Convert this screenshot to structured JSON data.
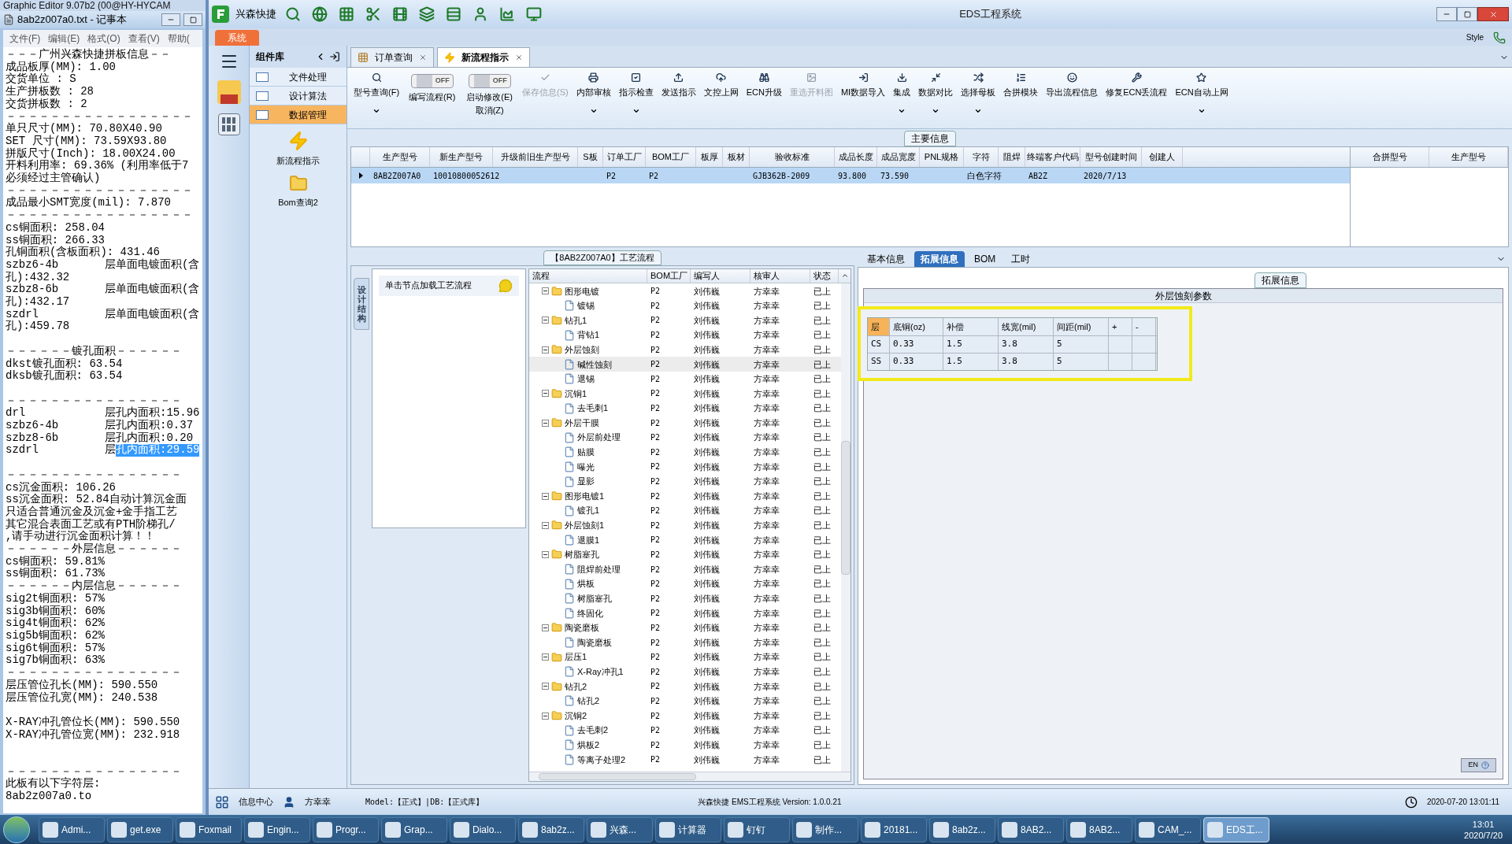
{
  "notepad": {
    "behind_title": "Graphic Editor 9.07b2 (00@HY-HYCAM",
    "title": "8ab2z007a0.txt - 记事本",
    "menu": [
      "文件(F)",
      "编辑(E)",
      "格式(O)",
      "查看(V)",
      "帮助("
    ],
    "lines": [
      {
        "kind": "text",
        "text": "－－－广州兴森快捷拼板信息－－"
      },
      {
        "kind": "text",
        "text": "成品板厚(MM): 1.00"
      },
      {
        "kind": "text",
        "text": "交货单位 : S"
      },
      {
        "kind": "text",
        "text": "生产拼板数 : 28"
      },
      {
        "kind": "text",
        "text": "交货拼板数 : 2"
      },
      {
        "kind": "text",
        "text": "－－－－－－－－－－－－－－－－－"
      },
      {
        "kind": "text",
        "text": "单只尺寸(MM): 70.80X40.90"
      },
      {
        "kind": "text",
        "text": "SET 尺寸(MM): 73.59X93.80"
      },
      {
        "kind": "text",
        "text": "拼版尺寸(Inch): 18.00X24.00"
      },
      {
        "kind": "text",
        "text": "开料利用率: 69.36% (利用率低于7"
      },
      {
        "kind": "text",
        "text": "必须经过主管确认)"
      },
      {
        "kind": "text",
        "text": "－－－－－－－－－－－－－－－－－"
      },
      {
        "kind": "text",
        "text": "成品最小SMT宽度(mil): 7.870"
      },
      {
        "kind": "text",
        "text": "－－－－－－－－－－－－－－－－－"
      },
      {
        "kind": "text",
        "text": "cs铜面积: 258.04"
      },
      {
        "kind": "text",
        "text": "ss铜面积: 266.33"
      },
      {
        "kind": "text",
        "text": "孔铜面积(含板面积): 431.46"
      },
      {
        "kind": "text",
        "text": "szbz6-4b       层单面电镀面积(含"
      },
      {
        "kind": "text",
        "text": "孔):432.32"
      },
      {
        "kind": "text",
        "text": "szbz8-6b       层单面电镀面积(含"
      },
      {
        "kind": "text",
        "text": "孔):432.17"
      },
      {
        "kind": "text",
        "text": "szdrl          层单面电镀面积(含"
      },
      {
        "kind": "text",
        "text": "孔):459.78"
      },
      {
        "kind": "blank"
      },
      {
        "kind": "text",
        "text": "－－－－－－镀孔面积－－－－－－"
      },
      {
        "kind": "text",
        "text": "dkst镀孔面积: 63.54"
      },
      {
        "kind": "text",
        "text": "dksb镀孔面积: 63.54"
      },
      {
        "kind": "blank"
      },
      {
        "kind": "text",
        "text": "－－－－－－－－－－－－－－－－"
      },
      {
        "kind": "text",
        "text": "drl            层孔内面积:15.96"
      },
      {
        "kind": "text",
        "text": "szbz6-4b       层孔内面积:0.37"
      },
      {
        "kind": "text",
        "text": "szbz8-6b       层孔内面积:0.20"
      },
      {
        "kind": "highlight",
        "text": "szdrl          层",
        "highlight": "孔内面积:29.59"
      },
      {
        "kind": "blank"
      },
      {
        "kind": "text",
        "text": "－－－－－－－－－－－－－－－－"
      },
      {
        "kind": "text",
        "text": "cs沉金面积: 106.26"
      },
      {
        "kind": "text",
        "text": "ss沉金面积: 52.84自动计算沉金面"
      },
      {
        "kind": "text",
        "text": "只适合普通沉金及沉金+金手指工艺"
      },
      {
        "kind": "text",
        "text": "其它混合表面工艺或有PTH阶梯孔/"
      },
      {
        "kind": "text",
        "text": ",请手动进行沉金面积计算！！"
      },
      {
        "kind": "text",
        "text": "－－－－－－外层信息－－－－－－"
      },
      {
        "kind": "text",
        "text": "cs铜面积: 59.81%"
      },
      {
        "kind": "text",
        "text": "ss铜面积: 61.73%"
      },
      {
        "kind": "text",
        "text": "－－－－－－内层信息－－－－－－"
      },
      {
        "kind": "text",
        "text": "sig2t铜面积: 57%"
      },
      {
        "kind": "text",
        "text": "sig3b铜面积: 60%"
      },
      {
        "kind": "text",
        "text": "sig4t铜面积: 62%"
      },
      {
        "kind": "text",
        "text": "sig5b铜面积: 62%"
      },
      {
        "kind": "text",
        "text": "sig6t铜面积: 57%"
      },
      {
        "kind": "text",
        "text": "sig7b铜面积: 63%"
      },
      {
        "kind": "text",
        "text": "－－－－－－－－－－－－－－－－"
      },
      {
        "kind": "text",
        "text": "层压管位孔长(MM): 590.550"
      },
      {
        "kind": "text",
        "text": "层压管位孔宽(MM): 240.538"
      },
      {
        "kind": "blank"
      },
      {
        "kind": "text",
        "text": "X-RAY冲孔管位长(MM): 590.550"
      },
      {
        "kind": "text",
        "text": "X-RAY冲孔管位宽(MM): 232.918"
      },
      {
        "kind": "blank"
      },
      {
        "kind": "blank"
      },
      {
        "kind": "text",
        "text": "－－－－－－－－－－－－－－－－"
      },
      {
        "kind": "text",
        "text": "此板有以下字符层:"
      },
      {
        "kind": "text",
        "text": "8ab2z007a0.to"
      }
    ]
  },
  "app": {
    "quick_title": "兴森快捷",
    "title": "EDS工程系统",
    "system_tab": "系统",
    "style_label": "Style"
  },
  "sidebar": {
    "header": "组件库",
    "items": [
      {
        "label": "文件处理",
        "selected": false
      },
      {
        "label": "设计算法",
        "selected": false
      },
      {
        "label": "数据管理",
        "selected": true
      }
    ],
    "launchers": [
      {
        "label": "新流程指示",
        "kind": "lightning"
      },
      {
        "label": "Bom查询2",
        "kind": "folder"
      }
    ]
  },
  "doc_tabs": [
    {
      "label": "订单查询",
      "selected": false
    },
    {
      "label": "新流程指示",
      "selected": true
    }
  ],
  "ribbon": [
    {
      "kind": "button",
      "label": "型号查询(F)",
      "dropdown": true,
      "disabled": false
    },
    {
      "kind": "toggle",
      "label": "编写流程(R)",
      "on": false,
      "state_text": "OFF"
    },
    {
      "kind": "toggle",
      "label": "启动修改(E)",
      "sub": "取消(Z)",
      "on": false,
      "state_text": "OFF"
    },
    {
      "kind": "button",
      "label": "保存信息(S)",
      "dropdown": false,
      "disabled": true
    },
    {
      "kind": "button",
      "label": "内部审核",
      "dropdown": true,
      "disabled": false
    },
    {
      "kind": "button",
      "label": "指示检查",
      "dropdown": true,
      "disabled": false
    },
    {
      "kind": "button",
      "label": "发送指示",
      "dropdown": false,
      "disabled": false
    },
    {
      "kind": "button",
      "label": "文控上网",
      "dropdown": false,
      "disabled": false
    },
    {
      "kind": "button",
      "label": "ECN升级",
      "dropdown": false,
      "disabled": false
    },
    {
      "kind": "button",
      "label": "重选开料图",
      "dropdown": false,
      "disabled": true
    },
    {
      "kind": "button",
      "label": "MI数据导入",
      "dropdown": false,
      "disabled": false
    },
    {
      "kind": "button",
      "label": "集成",
      "dropdown": true,
      "disabled": false
    },
    {
      "kind": "button",
      "label": "数据对比",
      "dropdown": true,
      "disabled": false
    },
    {
      "kind": "button",
      "label": "选择母板",
      "dropdown": true,
      "disabled": false
    },
    {
      "kind": "button",
      "label": "合拼模块",
      "dropdown": false,
      "disabled": false
    },
    {
      "kind": "button",
      "label": "导出流程信息",
      "dropdown": false,
      "disabled": false
    },
    {
      "kind": "button",
      "label": "修复ECN丢流程",
      "dropdown": false,
      "disabled": false
    },
    {
      "kind": "button",
      "label": "ECN自动上网",
      "dropdown": true,
      "disabled": false
    }
  ],
  "main_info": {
    "title": "主要信息",
    "columns": [
      "生产型号",
      "新生产型号",
      "升级前旧生产型号",
      "S板",
      "订单工厂",
      "BOM工厂",
      "板厚",
      "板材",
      "验收标准",
      "成品长度",
      "成品宽度",
      "PNL规格",
      "字符",
      "阻焊",
      "终端客户代码",
      "型号创建时间",
      "创建人"
    ],
    "rows": [
      {
        "selected": true,
        "cells": [
          "8AB2Z007A0",
          "10010800052612",
          null,
          null,
          "P2",
          "P2",
          null,
          null,
          "GJB362B-2009",
          "93.800",
          "73.590",
          null,
          "白色字符",
          null,
          "AB2Z",
          "2020/7/13",
          null
        ]
      }
    ],
    "side_columns": [
      "合拼型号",
      "生产型号"
    ]
  },
  "flow": {
    "title": "【8AB2Z007A0】工艺流程",
    "side_tab": "设计结构",
    "hint": "单击节点加载工艺流程",
    "columns": [
      "流程",
      "BOM工厂",
      "编写人",
      "核审人",
      "状态"
    ],
    "tree": [
      {
        "name": "图形电镀",
        "bom": "P2",
        "writer": "刘伟巍",
        "reviewer": "方幸幸",
        "status": "已上",
        "selected": false,
        "expanded": true,
        "children": [
          {
            "name": "镀锡",
            "bom": "P2",
            "writer": "刘伟巍",
            "reviewer": "方幸幸",
            "status": "已上",
            "selected": false
          }
        ]
      },
      {
        "name": "钻孔1",
        "bom": "P2",
        "writer": "刘伟巍",
        "reviewer": "方幸幸",
        "status": "已上",
        "selected": false,
        "expanded": true,
        "children": [
          {
            "name": "背钻1",
            "bom": "P2",
            "writer": "刘伟巍",
            "reviewer": "方幸幸",
            "status": "已上",
            "selected": false
          }
        ]
      },
      {
        "name": "外层蚀刻",
        "bom": "P2",
        "writer": "刘伟巍",
        "reviewer": "方幸幸",
        "status": "已上",
        "selected": false,
        "expanded": true,
        "children": [
          {
            "name": "碱性蚀刻",
            "bom": "P2",
            "writer": "刘伟巍",
            "reviewer": "方幸幸",
            "status": "已上",
            "selected": true
          },
          {
            "name": "退锡",
            "bom": "P2",
            "writer": "刘伟巍",
            "reviewer": "方幸幸",
            "status": "已上",
            "selected": false
          }
        ]
      },
      {
        "name": "沉铜1",
        "bom": "P2",
        "writer": "刘伟巍",
        "reviewer": "方幸幸",
        "status": "已上",
        "selected": false,
        "expanded": true,
        "children": [
          {
            "name": "去毛刺1",
            "bom": "P2",
            "writer": "刘伟巍",
            "reviewer": "方幸幸",
            "status": "已上",
            "selected": false
          }
        ]
      },
      {
        "name": "外层干膜",
        "bom": "P2",
        "writer": "刘伟巍",
        "reviewer": "方幸幸",
        "status": "已上",
        "selected": false,
        "expanded": true,
        "children": [
          {
            "name": "外层前处理",
            "bom": "P2",
            "writer": "刘伟巍",
            "reviewer": "方幸幸",
            "status": "已上",
            "selected": false
          },
          {
            "name": "贴膜",
            "bom": "P2",
            "writer": "刘伟巍",
            "reviewer": "方幸幸",
            "status": "已上",
            "selected": false
          },
          {
            "name": "曝光",
            "bom": "P2",
            "writer": "刘伟巍",
            "reviewer": "方幸幸",
            "status": "已上",
            "selected": false
          },
          {
            "name": "显影",
            "bom": "P2",
            "writer": "刘伟巍",
            "reviewer": "方幸幸",
            "status": "已上",
            "selected": false
          }
        ]
      },
      {
        "name": "图形电镀1",
        "bom": "P2",
        "writer": "刘伟巍",
        "reviewer": "方幸幸",
        "status": "已上",
        "selected": false,
        "expanded": true,
        "children": [
          {
            "name": "镀孔1",
            "bom": "P2",
            "writer": "刘伟巍",
            "reviewer": "方幸幸",
            "status": "已上",
            "selected": false
          }
        ]
      },
      {
        "name": "外层蚀刻1",
        "bom": "P2",
        "writer": "刘伟巍",
        "reviewer": "方幸幸",
        "status": "已上",
        "selected": false,
        "expanded": true,
        "children": [
          {
            "name": "退膜1",
            "bom": "P2",
            "writer": "刘伟巍",
            "reviewer": "方幸幸",
            "status": "已上",
            "selected": false
          }
        ]
      },
      {
        "name": "树脂塞孔",
        "bom": "P2",
        "writer": "刘伟巍",
        "reviewer": "方幸幸",
        "status": "已上",
        "selected": false,
        "expanded": true,
        "children": [
          {
            "name": "阻焊前处理",
            "bom": "P2",
            "writer": "刘伟巍",
            "reviewer": "方幸幸",
            "status": "已上",
            "selected": false
          },
          {
            "name": "烘板",
            "bom": "P2",
            "writer": "刘伟巍",
            "reviewer": "方幸幸",
            "status": "已上",
            "selected": false
          },
          {
            "name": "树脂塞孔",
            "bom": "P2",
            "writer": "刘伟巍",
            "reviewer": "方幸幸",
            "status": "已上",
            "selected": false
          },
          {
            "name": "终固化",
            "bom": "P2",
            "writer": "刘伟巍",
            "reviewer": "方幸幸",
            "status": "已上",
            "selected": false
          }
        ]
      },
      {
        "name": "陶瓷磨板",
        "bom": "P2",
        "writer": "刘伟巍",
        "reviewer": "方幸幸",
        "status": "已上",
        "selected": false,
        "expanded": true,
        "children": [
          {
            "name": "陶瓷磨板",
            "bom": "P2",
            "writer": "刘伟巍",
            "reviewer": "方幸幸",
            "status": "已上",
            "selected": false
          }
        ]
      },
      {
        "name": "层压1",
        "bom": "P2",
        "writer": "刘伟巍",
        "reviewer": "方幸幸",
        "status": "已上",
        "selected": false,
        "expanded": true,
        "children": [
          {
            "name": "X-Ray冲孔1",
            "bom": "P2",
            "writer": "刘伟巍",
            "reviewer": "方幸幸",
            "status": "已上",
            "selected": false
          }
        ]
      },
      {
        "name": "钻孔2",
        "bom": "P2",
        "writer": "刘伟巍",
        "reviewer": "方幸幸",
        "status": "已上",
        "selected": false,
        "expanded": true,
        "children": [
          {
            "name": "钻孔2",
            "bom": "P2",
            "writer": "刘伟巍",
            "reviewer": "方幸幸",
            "status": "已上",
            "selected": false
          }
        ]
      },
      {
        "name": "沉铜2",
        "bom": "P2",
        "writer": "刘伟巍",
        "reviewer": "方幸幸",
        "status": "已上",
        "selected": false,
        "expanded": true,
        "children": [
          {
            "name": "去毛刺2",
            "bom": "P2",
            "writer": "刘伟巍",
            "reviewer": "方幸幸",
            "status": "已上",
            "selected": false
          },
          {
            "name": "烘板2",
            "bom": "P2",
            "writer": "刘伟巍",
            "reviewer": "方幸幸",
            "status": "已上",
            "selected": false
          },
          {
            "name": "等离子处理2",
            "bom": "P2",
            "writer": "刘伟巍",
            "reviewer": "方幸幸",
            "status": "已上",
            "selected": false
          }
        ]
      }
    ]
  },
  "detail": {
    "tabs": [
      {
        "label": "基本信息",
        "selected": false
      },
      {
        "label": "拓展信息",
        "selected": true
      },
      {
        "label": "BOM",
        "selected": false
      },
      {
        "label": "工时",
        "selected": false
      }
    ],
    "group": "拓展信息",
    "section": "外层蚀刻参数",
    "columns": [
      "层",
      "底铜(oz)",
      "补偿",
      "线宽(mil)",
      "间距(mil)",
      "+",
      "-"
    ],
    "rows": [
      [
        "CS",
        "0.33",
        "1.5",
        "3.8",
        "5",
        null,
        null
      ],
      [
        "SS",
        "0.33",
        "1.5",
        "3.8",
        "5",
        null,
        null
      ]
    ],
    "ime": "EN"
  },
  "status_bar": {
    "center_label": "信息中心",
    "user": "方幸幸",
    "model": "Model:【正式】|DB:【正式库】",
    "version": "兴森快捷 EMS工程系统 Version: 1.0.0.21",
    "datetime": "2020-07-20 13:01:11"
  },
  "taskbar": {
    "items": [
      {
        "label": "Admi...",
        "selected": false
      },
      {
        "label": "get.exe",
        "selected": false
      },
      {
        "label": "Foxmail",
        "selected": false
      },
      {
        "label": "Engin...",
        "selected": false
      },
      {
        "label": "Progr...",
        "selected": false
      },
      {
        "label": "Grap...",
        "selected": false
      },
      {
        "label": "Dialo...",
        "selected": false
      },
      {
        "label": "8ab2z...",
        "selected": false
      },
      {
        "label": "兴森...",
        "selected": false
      },
      {
        "label": "计算器",
        "selected": false
      },
      {
        "label": "钉钉",
        "selected": false
      },
      {
        "label": "制作...",
        "selected": false
      },
      {
        "label": "20181...",
        "selected": false
      },
      {
        "label": "8ab2z...",
        "selected": false
      },
      {
        "label": "8AB2...",
        "selected": false
      },
      {
        "label": "8AB2...",
        "selected": false
      },
      {
        "label": "CAM_...",
        "selected": false
      },
      {
        "label": "EDS工...",
        "selected": true
      }
    ],
    "time": "13:01",
    "date": "2020/7/20"
  }
}
